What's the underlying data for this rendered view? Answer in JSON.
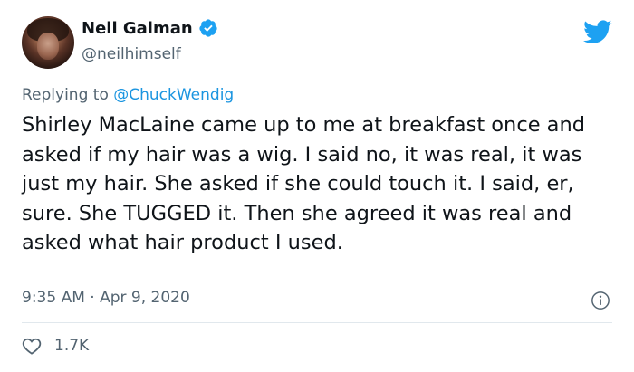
{
  "author": {
    "name": "Neil Gaiman",
    "handle": "@neilhimself",
    "verified": true,
    "avatar_icon": "avatar"
  },
  "brand": {
    "icon": "twitter-bird-icon",
    "color": "#1da1f2"
  },
  "reply": {
    "prefix": "Replying to ",
    "mention": "@ChuckWendig"
  },
  "tweet": {
    "text": "Shirley MacLaine came up to me at breakfast once and asked if my hair was a wig. I said no, it was real, it was just my hair. She asked if she could touch it. I said, er, sure. She TUGGED it. Then she agreed it was real and asked what hair product I used."
  },
  "meta": {
    "timestamp": "9:35 AM · Apr 9, 2020",
    "info_icon": "info-icon"
  },
  "engagement": {
    "like_icon": "heart-icon",
    "like_count": "1.7K"
  },
  "colors": {
    "text": "#0f1419",
    "secondary": "#536471",
    "link": "#1b95e0",
    "verified": "#1da1f2"
  }
}
